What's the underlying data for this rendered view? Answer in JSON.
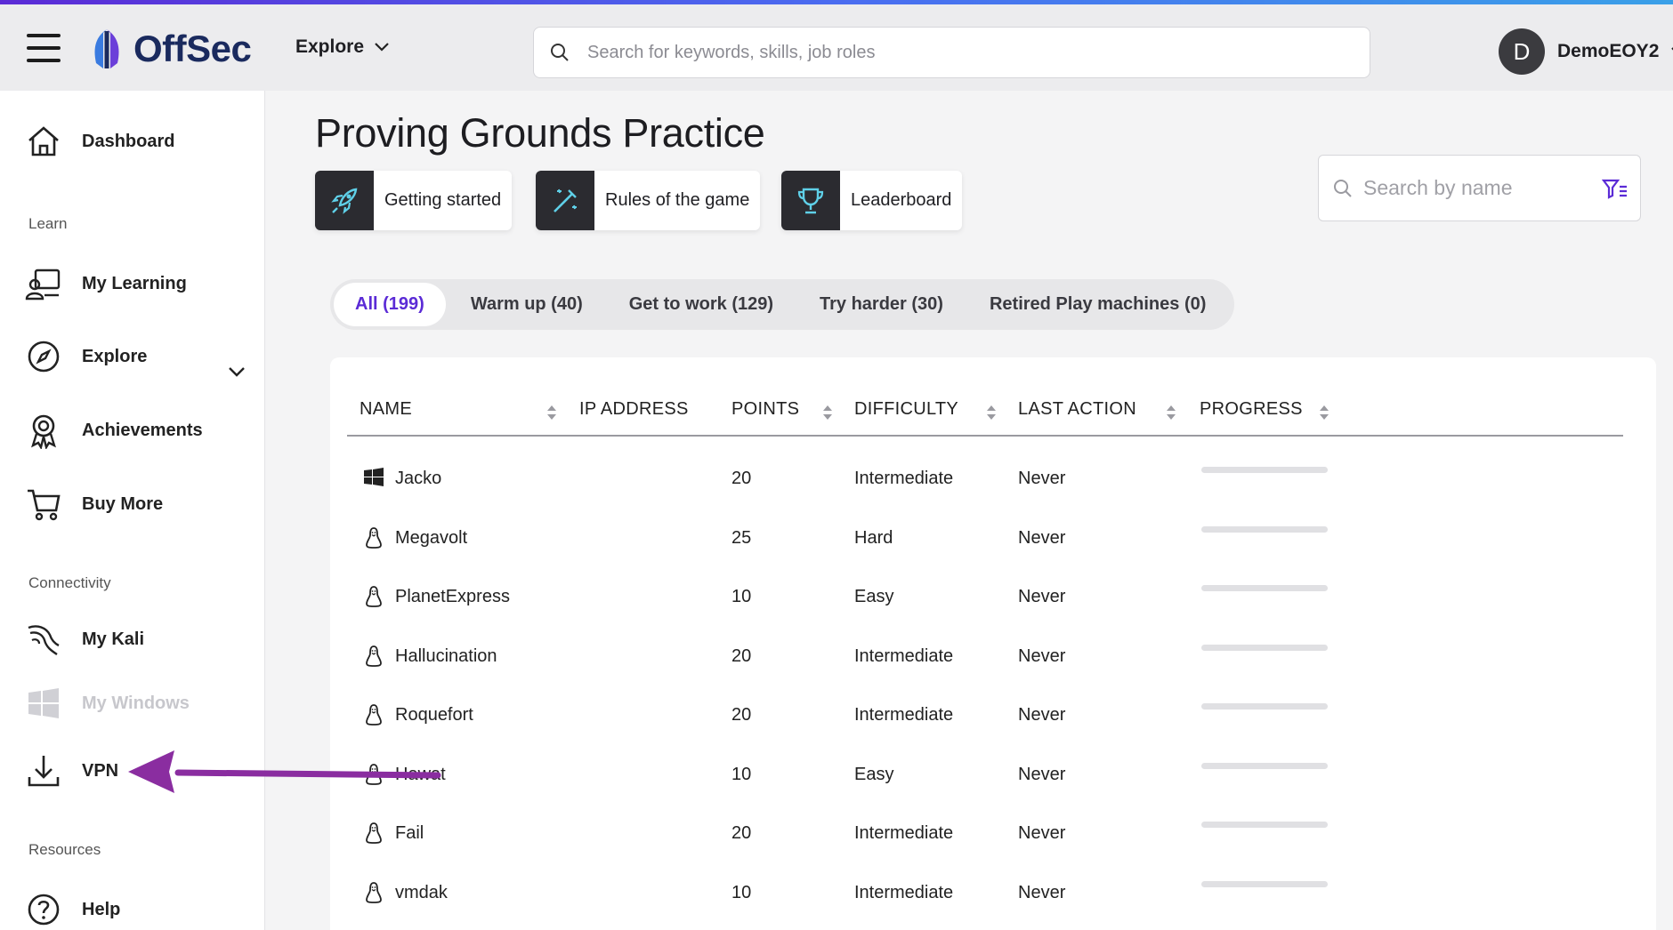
{
  "header": {
    "brand": "OffSec",
    "explore_label": "Explore",
    "search_placeholder": "Search for keywords, skills, job roles",
    "avatar_initial": "D",
    "username": "DemoEOY2"
  },
  "sidebar": {
    "dashboard": "Dashboard",
    "learn_section": "Learn",
    "my_learning": "My Learning",
    "explore": "Explore",
    "achievements": "Achievements",
    "buy_more": "Buy More",
    "connectivity_section": "Connectivity",
    "my_kali": "My Kali",
    "my_windows": "My Windows",
    "vpn": "VPN",
    "resources_section": "Resources",
    "help": "Help"
  },
  "main": {
    "title": "Proving Grounds Practice",
    "quick_links": [
      {
        "label": "Getting started",
        "icon": "rocket-icon"
      },
      {
        "label": "Rules of the game",
        "icon": "wand-icon"
      },
      {
        "label": "Leaderboard",
        "icon": "trophy-icon"
      }
    ],
    "name_search_placeholder": "Search by name",
    "tabs": [
      {
        "label": "All (199)",
        "active": true
      },
      {
        "label": "Warm up (40)",
        "active": false
      },
      {
        "label": "Get to work (129)",
        "active": false
      },
      {
        "label": "Try harder (30)",
        "active": false
      },
      {
        "label": "Retired Play machines (0)",
        "active": false
      }
    ],
    "table": {
      "columns": [
        "NAME",
        "IP ADDRESS",
        "POINTS",
        "DIFFICULTY",
        "LAST ACTION",
        "PROGRESS"
      ],
      "rows": [
        {
          "os": "windows-icon",
          "name": "Jacko",
          "ip": "",
          "points": "20",
          "difficulty": "Intermediate",
          "last_action": "Never",
          "progress": 0
        },
        {
          "os": "linux-icon",
          "name": "Megavolt",
          "ip": "",
          "points": "25",
          "difficulty": "Hard",
          "last_action": "Never",
          "progress": 0
        },
        {
          "os": "linux-icon",
          "name": "PlanetExpress",
          "ip": "",
          "points": "10",
          "difficulty": "Easy",
          "last_action": "Never",
          "progress": 0
        },
        {
          "os": "linux-icon",
          "name": "Hallucination",
          "ip": "",
          "points": "20",
          "difficulty": "Intermediate",
          "last_action": "Never",
          "progress": 0
        },
        {
          "os": "linux-icon",
          "name": "Roquefort",
          "ip": "",
          "points": "20",
          "difficulty": "Intermediate",
          "last_action": "Never",
          "progress": 0
        },
        {
          "os": "linux-icon",
          "name": "Hawat",
          "ip": "",
          "points": "10",
          "difficulty": "Easy",
          "last_action": "Never",
          "progress": 0
        },
        {
          "os": "linux-icon",
          "name": "Fail",
          "ip": "",
          "points": "20",
          "difficulty": "Intermediate",
          "last_action": "Never",
          "progress": 0
        },
        {
          "os": "linux-icon",
          "name": "vmdak",
          "ip": "",
          "points": "10",
          "difficulty": "Intermediate",
          "last_action": "Never",
          "progress": 0
        }
      ]
    }
  },
  "colors": {
    "accent": "#5b2bd6",
    "annotation_arrow": "#8a2da0",
    "icon_tile": "#2b2b30",
    "icon_glyph": "#5fd0e8"
  }
}
